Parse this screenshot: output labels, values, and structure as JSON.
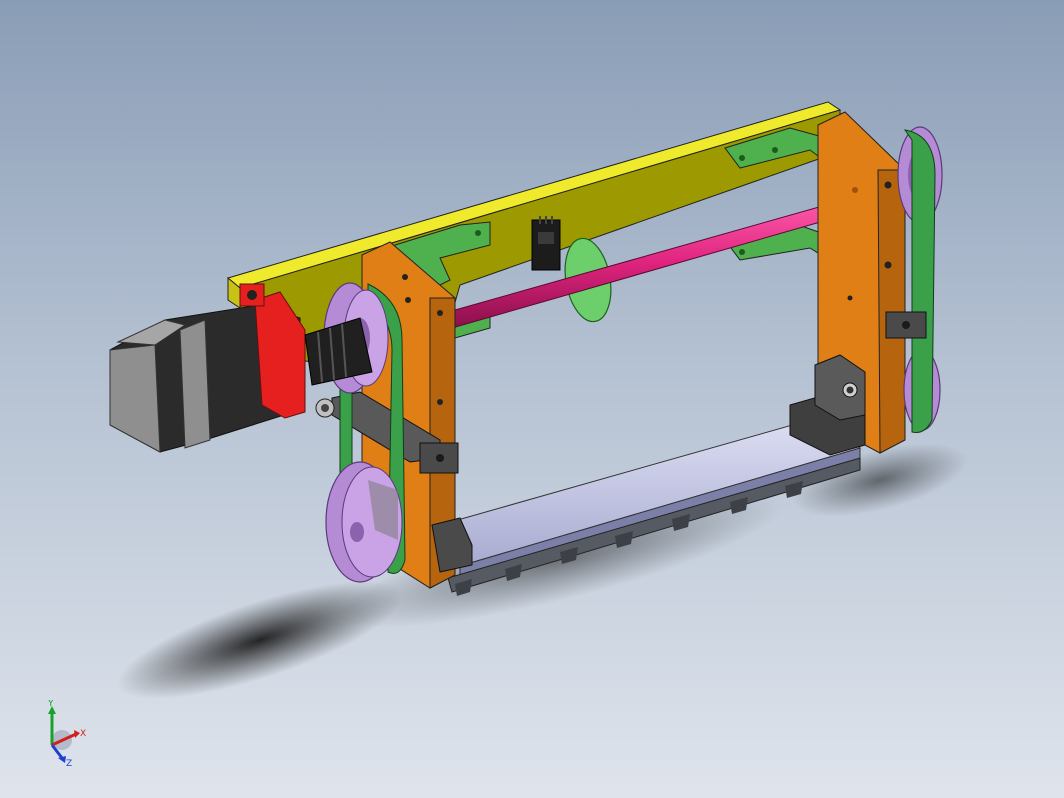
{
  "viewport": {
    "background_top": "#8a9db6",
    "background_bottom": "#dfe4ec"
  },
  "model": {
    "colors": {
      "base_plate": "#9c9a00",
      "base_plate_top": "#f0ea2c",
      "side_plate": "#e07f16",
      "side_plate_dark": "#b7640f",
      "bracket": "#4fb04e",
      "belt": "#3aa14a",
      "pulley": "#b58bd6",
      "shaft": "#e0247f",
      "disc": "#6ccf6c",
      "motor_body": "#2b2b2b",
      "motor_cap": "#8f8f8f",
      "motor_flange": "#e61f1f",
      "coupling": "#202020",
      "rail": "#c9cbe8",
      "rack": "#565a62",
      "bearing_block": "#4a4a4a"
    }
  },
  "triad": {
    "x_label": "X",
    "y_label": "Y",
    "z_label": "Z",
    "x_color": "#d21f1f",
    "y_color": "#1aa12a",
    "z_color": "#1f3fd2"
  }
}
